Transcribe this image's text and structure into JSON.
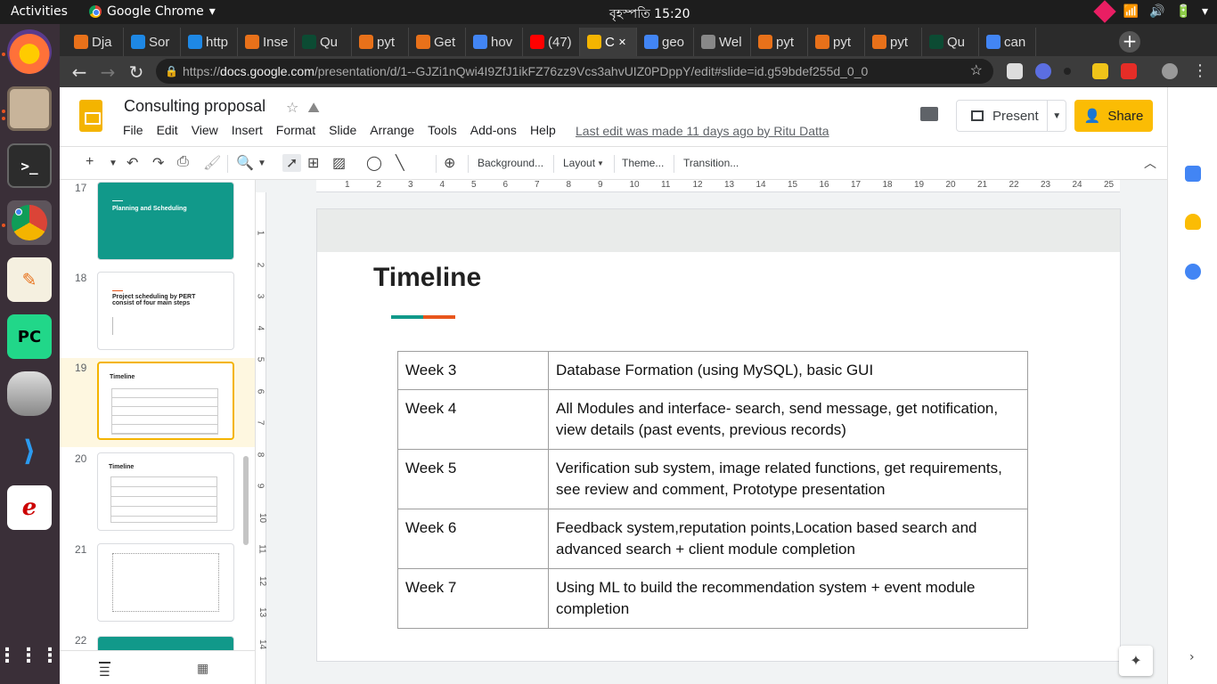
{
  "system": {
    "activities": "Activities",
    "app_name": "Google Chrome",
    "clock": "বৃহস্পতি 15:20"
  },
  "tabs": [
    {
      "label": "Dja",
      "color": "#e8711a"
    },
    {
      "label": "Sor",
      "color": "#1e88e5"
    },
    {
      "label": "http",
      "color": "#1e88e5"
    },
    {
      "label": "Inse",
      "color": "#e8711a"
    },
    {
      "label": "Qu",
      "color": "#0c4b33"
    },
    {
      "label": "pyt",
      "color": "#e8711a"
    },
    {
      "label": "Get",
      "color": "#e8711a"
    },
    {
      "label": "hov",
      "color": "#4285f4"
    },
    {
      "label": "(47)",
      "color": "#ff0000"
    },
    {
      "label": "C",
      "color": "#f4b400"
    },
    {
      "label": "geo",
      "color": "#4285f4"
    },
    {
      "label": "Wel",
      "color": "#888888"
    },
    {
      "label": "pyt",
      "color": "#e8711a"
    },
    {
      "label": "pyt",
      "color": "#e8711a"
    },
    {
      "label": "pyt",
      "color": "#e8711a"
    },
    {
      "label": "Qu",
      "color": "#0c4b33"
    },
    {
      "label": "can",
      "color": "#4285f4"
    }
  ],
  "address": {
    "prefix": "https://",
    "host": "docs.google.com",
    "path": "/presentation/d/1--GJZi1nQwi4I9ZfJ1ikFZ76zz9Vcs3ahvUIZ0PDppY/edit#slide=id.g59bdef255d_0_0"
  },
  "docs": {
    "title": "Consulting proposal",
    "menu": [
      "File",
      "Edit",
      "View",
      "Insert",
      "Format",
      "Slide",
      "Arrange",
      "Tools",
      "Add-ons",
      "Help"
    ],
    "last_edit": "Last edit was made 11 days ago by Ritu Datta",
    "present_label": "Present",
    "share_label": "Share"
  },
  "toolbar": {
    "background": "Background...",
    "layout": "Layout",
    "theme": "Theme...",
    "transition": "Transition..."
  },
  "filmstrip": [
    {
      "num": "17",
      "title": "Planning and Scheduling"
    },
    {
      "num": "18",
      "title": "Project scheduling by PERT consist of four main steps"
    },
    {
      "num": "19",
      "title": "Timeline"
    },
    {
      "num": "20",
      "title": "Timeline"
    },
    {
      "num": "21",
      "title": ""
    },
    {
      "num": "22",
      "title": ""
    }
  ],
  "ruler": {
    "h_ticks": [
      "1",
      "2",
      "3",
      "4",
      "5",
      "6",
      "7",
      "8",
      "9",
      "10",
      "11",
      "12",
      "13",
      "14",
      "15",
      "16",
      "17",
      "18",
      "19",
      "20",
      "21",
      "22",
      "23",
      "24",
      "25"
    ],
    "v_ticks": [
      "1",
      "2",
      "3",
      "4",
      "5",
      "6",
      "7",
      "8",
      "9",
      "10",
      "11",
      "12",
      "13",
      "14"
    ]
  },
  "slide": {
    "title": "Timeline",
    "rows": [
      {
        "week": "Week 3",
        "task": "Database Formation (using MySQL), basic GUI"
      },
      {
        "week": "Week 4",
        "task": "All Modules and interface- search, send message, get notification, view details (past events, previous records)"
      },
      {
        "week": "Week 5",
        "task": "Verification sub system, image related functions, get requirements, see review and comment, Prototype presentation"
      },
      {
        "week": "Week 6",
        "task": "Feedback system,reputation points,Location based search and advanced search  + client module completion"
      },
      {
        "week": "Week 7",
        "task": "Using ML to build the recommendation system  + event module completion"
      }
    ]
  },
  "colors": {
    "accent_green": "#11998a",
    "accent_red": "#e8561c",
    "share_yellow": "#fbbc04"
  }
}
